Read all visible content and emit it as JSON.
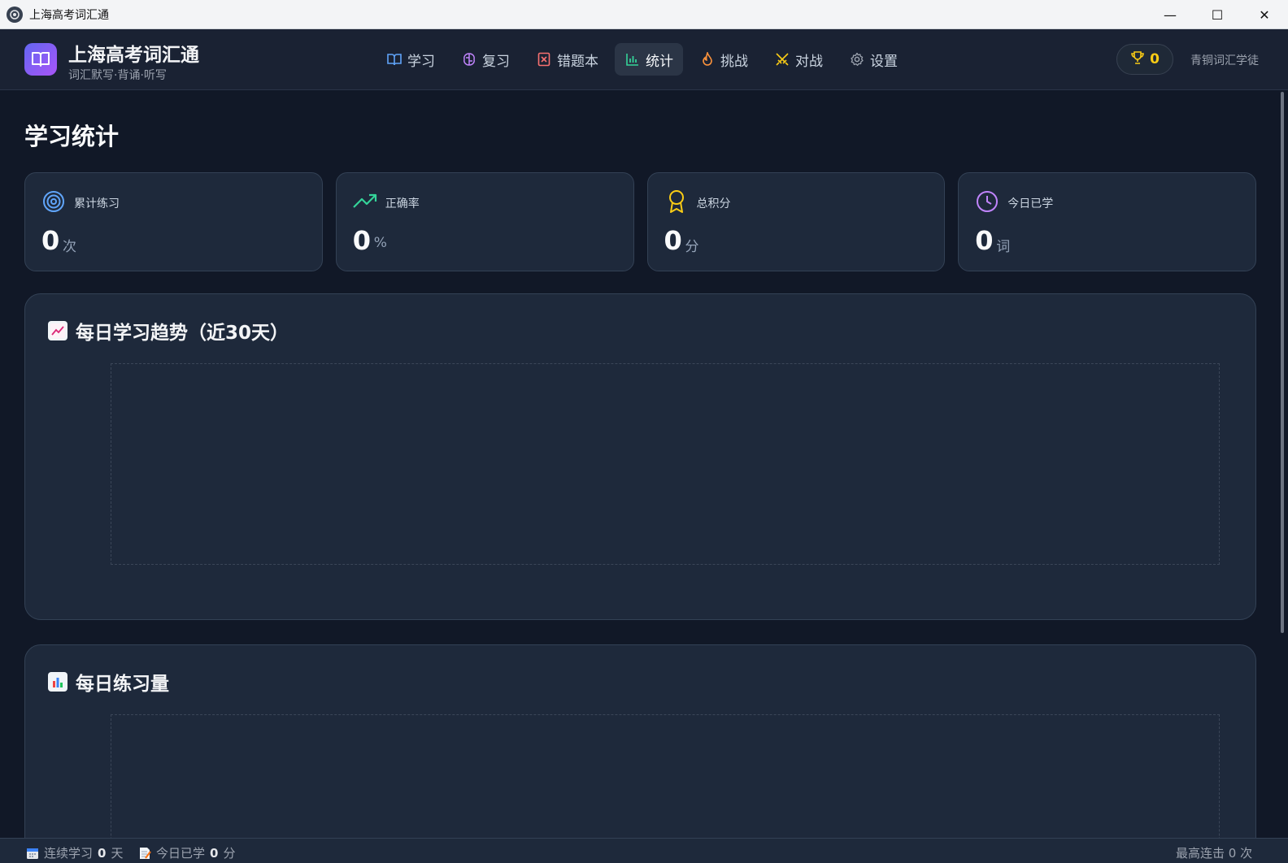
{
  "window": {
    "title": "上海高考词汇通",
    "minimize": "—",
    "maximize": "☐",
    "close": "✕"
  },
  "header": {
    "brand_title": "上海高考词汇通",
    "brand_sub": "词汇默写·背诵·听写",
    "nav": [
      {
        "label": "学习",
        "icon": "book-icon",
        "color": "#60a5fa"
      },
      {
        "label": "复习",
        "icon": "brain-icon",
        "color": "#c084fc"
      },
      {
        "label": "错题本",
        "icon": "x-square-icon",
        "color": "#f87171"
      },
      {
        "label": "统计",
        "icon": "bar-chart-icon",
        "color": "#34d399",
        "active": true
      },
      {
        "label": "挑战",
        "icon": "flame-icon",
        "color": "#fb923c"
      },
      {
        "label": "对战",
        "icon": "swords-icon",
        "color": "#facc15"
      },
      {
        "label": "设置",
        "icon": "gear-icon",
        "color": "#9ca3af"
      }
    ],
    "trophy_count": "0",
    "rank": "青铜词汇学徒"
  },
  "main": {
    "page_title": "学习统计",
    "cards": [
      {
        "label": "累计练习",
        "value": "0",
        "unit": "次",
        "icon": "target-icon",
        "color": "#60a5fa"
      },
      {
        "label": "正确率",
        "value": "0",
        "unit": "%",
        "icon": "trending-up-icon",
        "color": "#34d399"
      },
      {
        "label": "总积分",
        "value": "0",
        "unit": "分",
        "icon": "award-icon",
        "color": "#facc15"
      },
      {
        "label": "今日已学",
        "value": "0",
        "unit": "词",
        "icon": "clock-icon",
        "color": "#c084fc"
      }
    ],
    "trend_title": "每日学习趋势（近30天）",
    "volume_title": "每日练习量"
  },
  "status": {
    "streak_label": "连续学习",
    "streak_value": "0",
    "streak_unit": "天",
    "today_label": "今日已学",
    "today_value": "0",
    "today_unit": "分",
    "combo_text": "最高连击 0 次"
  }
}
